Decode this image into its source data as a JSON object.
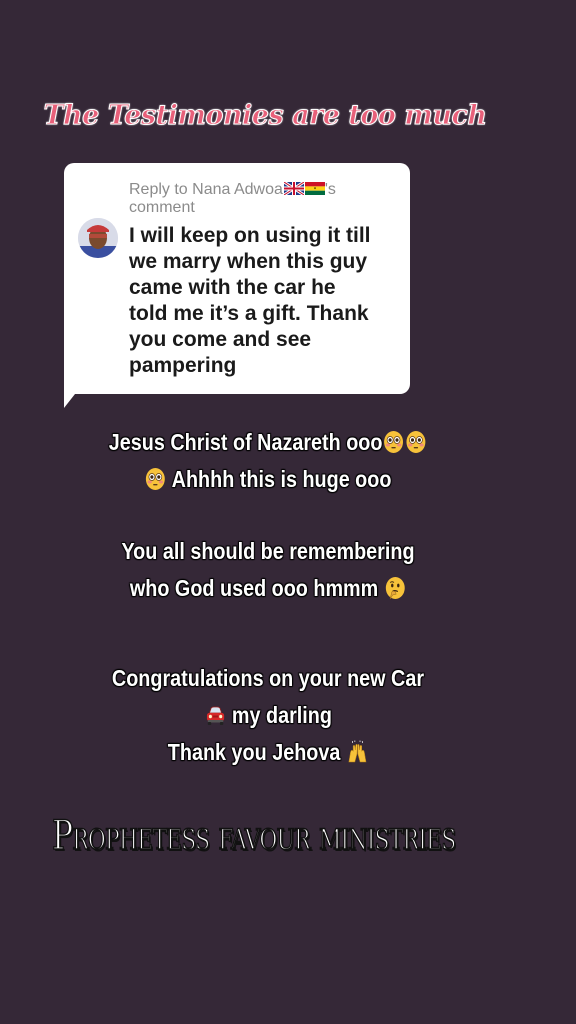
{
  "headline": "The Testimonies are too much",
  "reply": {
    "header_prefix": "Reply to Nana Adwoa",
    "header_suffix": "'s",
    "header_line2": "comment",
    "flags": [
      "uk-flag-icon",
      "ghana-flag-icon"
    ],
    "text_lines": [
      "I will keep on using it till",
      "we marry when this guy",
      "came with the car he",
      "told me it’s a gift. Thank",
      "you come and see",
      "pampering"
    ]
  },
  "caption1": {
    "line1": "Jesus Christ of Nazareth ooo",
    "line2": "Ahhhh this is huge ooo"
  },
  "caption2": {
    "line1": "You all should be remembering",
    "line2": "who God used ooo hmmm"
  },
  "caption3": {
    "line1": "Congratulations on your new Car",
    "line2": "my darling",
    "line3": "Thank you Jehova"
  },
  "signature": "Prophetess favour ministries",
  "colors": {
    "background": "#352837",
    "headline": "#e8607a",
    "card": "#ffffff"
  }
}
